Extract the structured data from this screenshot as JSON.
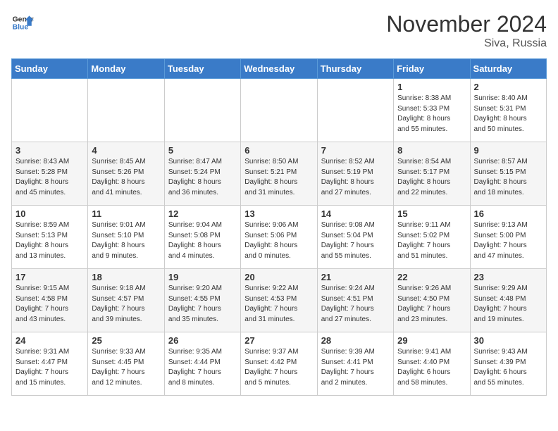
{
  "header": {
    "logo_line1": "General",
    "logo_line2": "Blue",
    "month": "November 2024",
    "location": "Siva, Russia"
  },
  "weekdays": [
    "Sunday",
    "Monday",
    "Tuesday",
    "Wednesday",
    "Thursday",
    "Friday",
    "Saturday"
  ],
  "weeks": [
    [
      {
        "day": "",
        "info": ""
      },
      {
        "day": "",
        "info": ""
      },
      {
        "day": "",
        "info": ""
      },
      {
        "day": "",
        "info": ""
      },
      {
        "day": "",
        "info": ""
      },
      {
        "day": "1",
        "info": "Sunrise: 8:38 AM\nSunset: 5:33 PM\nDaylight: 8 hours\nand 55 minutes."
      },
      {
        "day": "2",
        "info": "Sunrise: 8:40 AM\nSunset: 5:31 PM\nDaylight: 8 hours\nand 50 minutes."
      }
    ],
    [
      {
        "day": "3",
        "info": "Sunrise: 8:43 AM\nSunset: 5:28 PM\nDaylight: 8 hours\nand 45 minutes."
      },
      {
        "day": "4",
        "info": "Sunrise: 8:45 AM\nSunset: 5:26 PM\nDaylight: 8 hours\nand 41 minutes."
      },
      {
        "day": "5",
        "info": "Sunrise: 8:47 AM\nSunset: 5:24 PM\nDaylight: 8 hours\nand 36 minutes."
      },
      {
        "day": "6",
        "info": "Sunrise: 8:50 AM\nSunset: 5:21 PM\nDaylight: 8 hours\nand 31 minutes."
      },
      {
        "day": "7",
        "info": "Sunrise: 8:52 AM\nSunset: 5:19 PM\nDaylight: 8 hours\nand 27 minutes."
      },
      {
        "day": "8",
        "info": "Sunrise: 8:54 AM\nSunset: 5:17 PM\nDaylight: 8 hours\nand 22 minutes."
      },
      {
        "day": "9",
        "info": "Sunrise: 8:57 AM\nSunset: 5:15 PM\nDaylight: 8 hours\nand 18 minutes."
      }
    ],
    [
      {
        "day": "10",
        "info": "Sunrise: 8:59 AM\nSunset: 5:13 PM\nDaylight: 8 hours\nand 13 minutes."
      },
      {
        "day": "11",
        "info": "Sunrise: 9:01 AM\nSunset: 5:10 PM\nDaylight: 8 hours\nand 9 minutes."
      },
      {
        "day": "12",
        "info": "Sunrise: 9:04 AM\nSunset: 5:08 PM\nDaylight: 8 hours\nand 4 minutes."
      },
      {
        "day": "13",
        "info": "Sunrise: 9:06 AM\nSunset: 5:06 PM\nDaylight: 8 hours\nand 0 minutes."
      },
      {
        "day": "14",
        "info": "Sunrise: 9:08 AM\nSunset: 5:04 PM\nDaylight: 7 hours\nand 55 minutes."
      },
      {
        "day": "15",
        "info": "Sunrise: 9:11 AM\nSunset: 5:02 PM\nDaylight: 7 hours\nand 51 minutes."
      },
      {
        "day": "16",
        "info": "Sunrise: 9:13 AM\nSunset: 5:00 PM\nDaylight: 7 hours\nand 47 minutes."
      }
    ],
    [
      {
        "day": "17",
        "info": "Sunrise: 9:15 AM\nSunset: 4:58 PM\nDaylight: 7 hours\nand 43 minutes."
      },
      {
        "day": "18",
        "info": "Sunrise: 9:18 AM\nSunset: 4:57 PM\nDaylight: 7 hours\nand 39 minutes."
      },
      {
        "day": "19",
        "info": "Sunrise: 9:20 AM\nSunset: 4:55 PM\nDaylight: 7 hours\nand 35 minutes."
      },
      {
        "day": "20",
        "info": "Sunrise: 9:22 AM\nSunset: 4:53 PM\nDaylight: 7 hours\nand 31 minutes."
      },
      {
        "day": "21",
        "info": "Sunrise: 9:24 AM\nSunset: 4:51 PM\nDaylight: 7 hours\nand 27 minutes."
      },
      {
        "day": "22",
        "info": "Sunrise: 9:26 AM\nSunset: 4:50 PM\nDaylight: 7 hours\nand 23 minutes."
      },
      {
        "day": "23",
        "info": "Sunrise: 9:29 AM\nSunset: 4:48 PM\nDaylight: 7 hours\nand 19 minutes."
      }
    ],
    [
      {
        "day": "24",
        "info": "Sunrise: 9:31 AM\nSunset: 4:47 PM\nDaylight: 7 hours\nand 15 minutes."
      },
      {
        "day": "25",
        "info": "Sunrise: 9:33 AM\nSunset: 4:45 PM\nDaylight: 7 hours\nand 12 minutes."
      },
      {
        "day": "26",
        "info": "Sunrise: 9:35 AM\nSunset: 4:44 PM\nDaylight: 7 hours\nand 8 minutes."
      },
      {
        "day": "27",
        "info": "Sunrise: 9:37 AM\nSunset: 4:42 PM\nDaylight: 7 hours\nand 5 minutes."
      },
      {
        "day": "28",
        "info": "Sunrise: 9:39 AM\nSunset: 4:41 PM\nDaylight: 7 hours\nand 2 minutes."
      },
      {
        "day": "29",
        "info": "Sunrise: 9:41 AM\nSunset: 4:40 PM\nDaylight: 6 hours\nand 58 minutes."
      },
      {
        "day": "30",
        "info": "Sunrise: 9:43 AM\nSunset: 4:39 PM\nDaylight: 6 hours\nand 55 minutes."
      }
    ]
  ]
}
